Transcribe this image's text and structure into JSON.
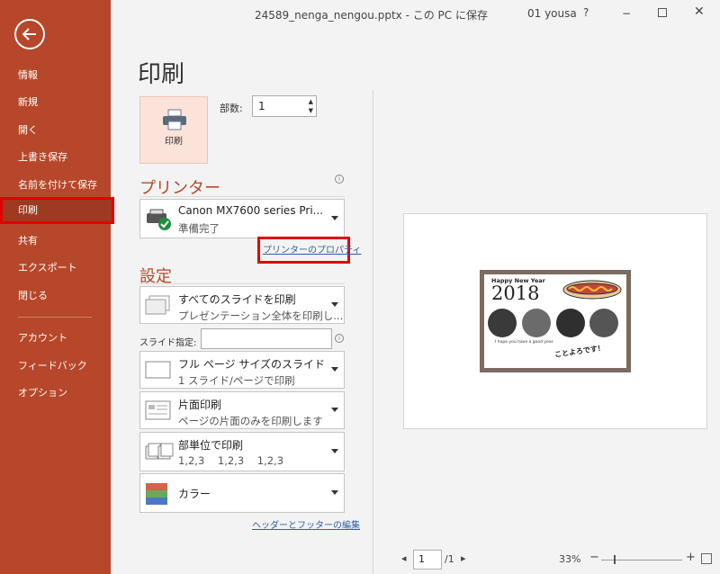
{
  "titlebar": {
    "filename": "24589_nenga_nengou.pptx - この PC に保存",
    "user": "01 yousa",
    "help": "?",
    "minimize": "−",
    "close": "✕"
  },
  "sidebar": {
    "items": [
      {
        "label": "情報"
      },
      {
        "label": "新規"
      },
      {
        "label": "開く"
      },
      {
        "label": "上書き保存"
      },
      {
        "label": "名前を付けて保存"
      },
      {
        "label": "印刷"
      },
      {
        "label": "共有"
      },
      {
        "label": "エクスポート"
      },
      {
        "label": "閉じる"
      },
      {
        "label": "アカウント"
      },
      {
        "label": "フィードバック"
      },
      {
        "label": "オプション"
      }
    ]
  },
  "print": {
    "page_title": "印刷",
    "print_button_label": "印刷",
    "copies_label": "部数:",
    "copies_value": "1"
  },
  "printer": {
    "heading": "プリンター",
    "name": "Canon MX7600 series Pri...",
    "status": "準備完了",
    "properties_link": "プリンターのプロパティ"
  },
  "settings": {
    "heading": "設定",
    "slides_range": {
      "title": "すべてのスライドを印刷",
      "desc": "プレゼンテーション全体を印刷し..."
    },
    "slide_spec_label": "スライド指定:",
    "layout": {
      "title": "フル ページ サイズのスライド",
      "desc": "1 スライド/ページで印刷"
    },
    "sides": {
      "title": "片面印刷",
      "desc": "ページの片面のみを印刷します"
    },
    "collate": {
      "title": "部単位で印刷",
      "desc": "1,2,3    1,2,3    1,2,3"
    },
    "color": {
      "title": "カラー"
    },
    "header_footer_link": "ヘッダーとフッターの編集"
  },
  "preview": {
    "card_greeting": "Happy New Year",
    "card_year": "2018",
    "card_message": "I hope you have a good year.",
    "card_closing": "ことよろです！"
  },
  "bottom": {
    "page_value": "1",
    "page_total": "/1",
    "zoom": "33%"
  },
  "colors": {
    "accent": "#b7472a",
    "active_nav": "#9e3a21",
    "highlight": "#e00000",
    "link": "#2f5ea6"
  }
}
